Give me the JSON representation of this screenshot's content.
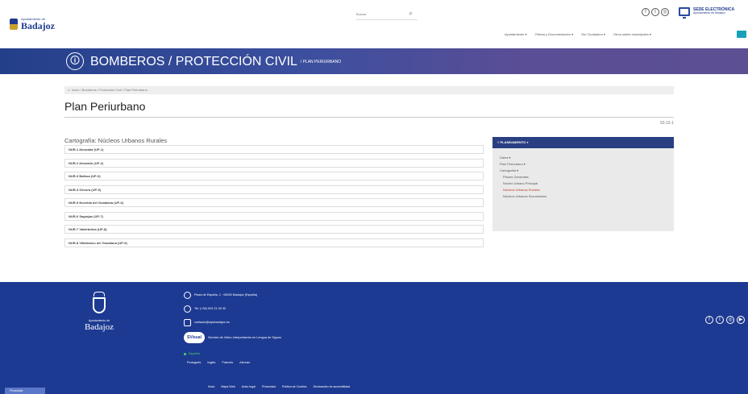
{
  "header": {
    "logo": {
      "small": "Ayuntamiento de",
      "big": "Badajoz"
    },
    "search": {
      "placeholder": "Buscar"
    },
    "sede": {
      "title": "SEDE ELECTRÓNICA",
      "subtitle": "Ayuntamiento de Badajoz"
    },
    "social_icons": [
      "facebook-icon",
      "twitter-icon",
      "instagram-icon"
    ],
    "nav": [
      "Ayuntamiento ▾",
      "Oficina y Documentación ▾",
      "Ser Ciudadano ▾",
      "Otros sedes municipales ▾"
    ]
  },
  "banner": {
    "title": "BOMBEROS / PROTECCIÓN CIVIL",
    "subtitle": "/ PLAN PERIURBANO"
  },
  "breadcrumb": "Inicio / Bomberos / Protección Civil / Plan Periurbano",
  "page": {
    "title": "Plan Periurbano",
    "code": "50.15-1"
  },
  "section": {
    "title": "Cartografía: Núcleos Urbanos Rurales",
    "items": [
      "NUR-1 Alcazaba (UP-1)",
      "NUR-2 Alvarado (UP-2)",
      "NUR-3 Balboa (UP-3)",
      "NUR-4 Gévora (UP-5)",
      "NUR-5 Novelda del Guadiana (UP-6)",
      "NUR-6 Sagrajas (UP-7)",
      "NUR-7 Valdebótoa (UP-8)",
      "NUR-8 Villafranco del Guadiana (UP-9)"
    ]
  },
  "sidebar": {
    "heading": "≡ PLANEAMIENTO ▾",
    "menu": [
      {
        "label": "Datos ▾",
        "level": 0,
        "active": false
      },
      {
        "label": "Plan Periurbano ▾",
        "level": 0,
        "active": false
      },
      {
        "label": "Cartografía ▾",
        "level": 0,
        "active": false
      },
      {
        "label": "Planos Generales",
        "level": 1,
        "active": false
      },
      {
        "label": "Núcleo Urbano Principal",
        "level": 1,
        "active": false
      },
      {
        "label": "Núcleos Urbanos Rurales",
        "level": 1,
        "active": true
      },
      {
        "label": "Núcleos Urbanos Secundarios",
        "level": 1,
        "active": false
      }
    ]
  },
  "footer": {
    "logo": {
      "small": "Ayuntamiento de",
      "big": "Badajoz"
    },
    "address": "Plaza de España, 1 · 06002 Badajoz (España)",
    "phone": "Tel: (+34) 924 21 00 00",
    "email": "contacto@aytobadajoz.es",
    "signo_badge": "SVisual",
    "signo": "Servicio de Video-Interpretación en Lengua de Signos",
    "language_current": "Español",
    "languages": [
      "Português",
      "Inglés",
      "Francés",
      "Alemán"
    ],
    "links": [
      "Inicio",
      "Mapa Web",
      "Aviso legal",
      "Privacidad",
      "Política de Cookies",
      "Declaración de accesibilidad"
    ],
    "privacy_tab": "Privacidad",
    "social_icons": [
      "facebook-icon",
      "twitter-icon",
      "instagram-icon",
      "youtube-icon"
    ]
  },
  "colors": {
    "brand": "#1d3a92",
    "accent_active": "#c0392b",
    "teal": "#17a2b8"
  }
}
